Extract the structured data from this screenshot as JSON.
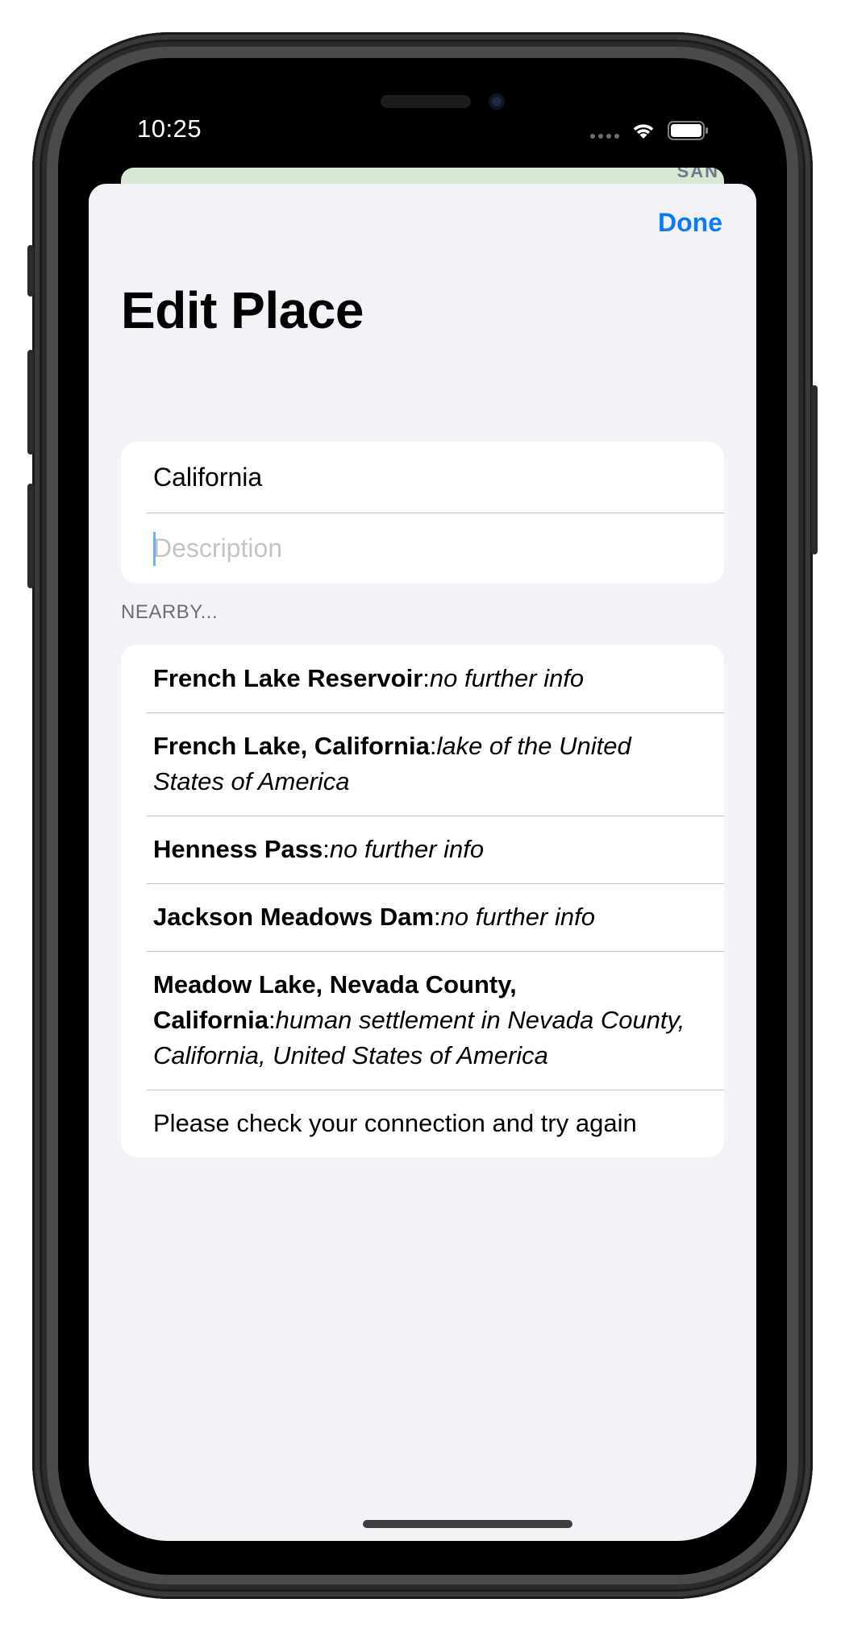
{
  "status_bar": {
    "time": "10:25"
  },
  "sheet": {
    "done_label": "Done",
    "title": "Edit Place",
    "name_value": "California",
    "description_placeholder": "Description",
    "section_header": "NEARBY...",
    "nearby": [
      {
        "name": "French Lake Reservoir",
        "description": "no further info"
      },
      {
        "name": "French Lake, California",
        "description": "lake of the United States of America"
      },
      {
        "name": "Henness Pass",
        "description": "no further info"
      },
      {
        "name": "Jackson Meadows Dam",
        "description": "no further info"
      },
      {
        "name": "Meadow Lake, Nevada County, California",
        "description": "human settlement in Nevada County, California, United States of America"
      }
    ],
    "error_message": "Please check your connection and try again"
  },
  "map_peek_label": "SAN",
  "colors": {
    "accent": "#0a7aff",
    "sheet_bg": "#f2f2f7",
    "separator": "#c6c6c8"
  },
  "icons": [
    "wifi-icon",
    "battery-icon",
    "signal-icon"
  ]
}
